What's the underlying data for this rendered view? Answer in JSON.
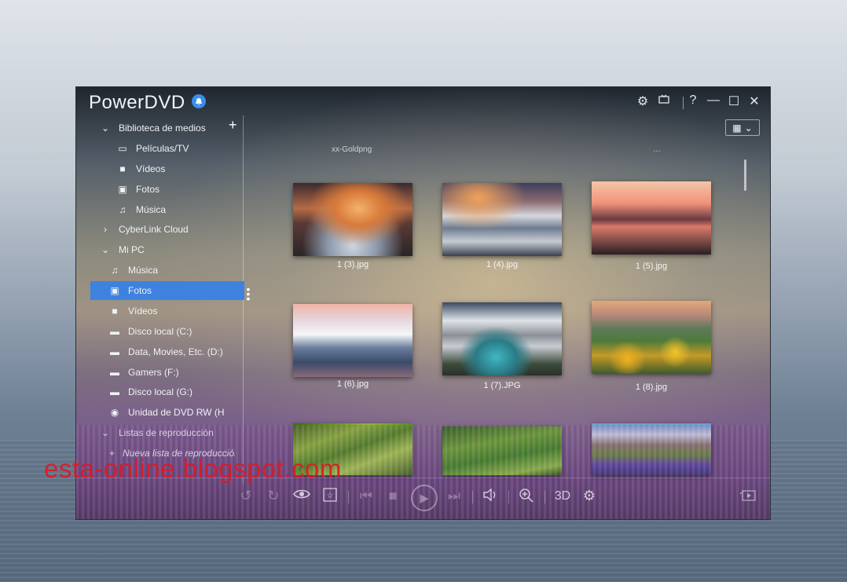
{
  "app": {
    "title": "PowerDVD"
  },
  "window_controls": {
    "settings": "⚙",
    "tv": "📺",
    "help": "?",
    "minimize": "—",
    "maximize": "☐",
    "close": "✕"
  },
  "view_button": {
    "icon": "▦",
    "arrow": "⌄"
  },
  "sidebar": {
    "add": "+",
    "items": [
      {
        "label": "Biblioteca de medios",
        "icon": "chevron-down",
        "glyph": "⌄"
      },
      {
        "label": "Películas/TV",
        "glyph": "▭"
      },
      {
        "label": "Vídeos",
        "glyph": "■"
      },
      {
        "label": "Fotos",
        "glyph": "▣"
      },
      {
        "label": "Música",
        "glyph": "♫"
      },
      {
        "label": "CyberLink Cloud",
        "glyph": "›"
      },
      {
        "label": "Mi PC",
        "glyph": "⌄"
      },
      {
        "label": "Música",
        "glyph": "♫"
      },
      {
        "label": "Fotos",
        "glyph": "▣"
      },
      {
        "label": "Vídeos",
        "glyph": "■"
      },
      {
        "label": "Disco local (C:)",
        "glyph": "▬"
      },
      {
        "label": "Data, Movies, Etc. (D:)",
        "glyph": "▬"
      },
      {
        "label": "Gamers  (F:)",
        "glyph": "▬"
      },
      {
        "label": "Disco local (G:)",
        "glyph": "▬"
      },
      {
        "label": "Unidad de DVD RW (H",
        "glyph": "◉"
      },
      {
        "label": "Listas de reproducción",
        "glyph": "⌄"
      },
      {
        "label": "Nueva lista de reproducción",
        "glyph": "+"
      }
    ]
  },
  "grid": {
    "partial_top": [
      "xx-Goldpng",
      "…"
    ],
    "items": [
      {
        "caption": "1 (3).jpg"
      },
      {
        "caption": "1 (4).jpg"
      },
      {
        "caption": "1 (5).jpg"
      },
      {
        "caption": "1 (6).jpg"
      },
      {
        "caption": "1 (7).JPG"
      },
      {
        "caption": "1 (8).jpg"
      },
      {
        "caption": ""
      },
      {
        "caption": ""
      },
      {
        "caption": ""
      }
    ]
  },
  "player": {
    "rewind": "↺",
    "forward": "↻",
    "eye": "👁",
    "star": "☆",
    "prev": "⏮",
    "stop": "■",
    "play": "▶",
    "next": "⏭",
    "volume": "🔈",
    "zoom": "⊕",
    "label_3d": "3D",
    "settings": "⚙",
    "mini": "▷"
  },
  "watermark": "esta-online.blogspot.com"
}
